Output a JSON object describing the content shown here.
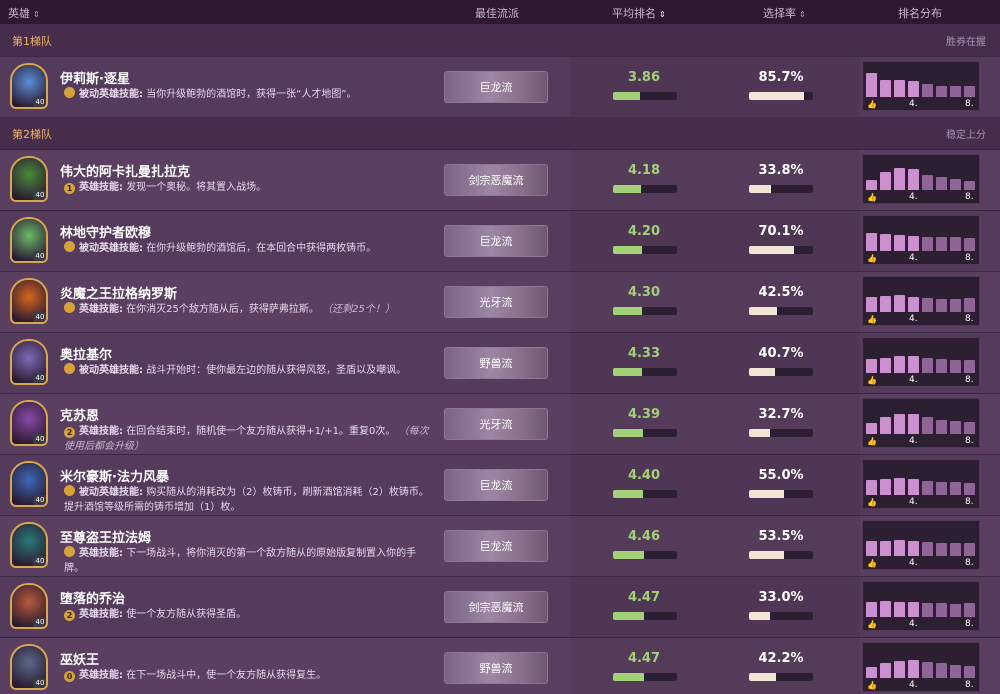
{
  "header": {
    "hero": "英雄",
    "best_build": "最佳流派",
    "avg_rank": "平均排名",
    "pick_rate": "选择率",
    "rank_dist": "排名分布"
  },
  "tiers": [
    {
      "name": "第1梯队",
      "hint": "胜券在握"
    },
    {
      "name": "第2梯队",
      "hint": "稳定上分"
    }
  ],
  "distribution_labels": {
    "low": "4.",
    "high": "8."
  },
  "colors": {
    "avg": "#a3d177",
    "pick": "#f1e6d6",
    "dist_top": "#cc8fd0",
    "dist_bottom": "#8e6596"
  },
  "heroes": [
    {
      "name": "伊莉斯·逐星",
      "cost": "",
      "type": "被动英雄技能:",
      "text": "当你升级鲍勃的酒馆时，获得一张“人才地图”。",
      "note": "",
      "build": "巨龙流",
      "avg": "3.86",
      "avg_pct": 0.42,
      "pick": "85.7%",
      "pick_rate": 0.857,
      "dist": [
        0.85,
        0.62,
        0.6,
        0.58,
        0.45,
        0.4,
        0.38,
        0.4
      ],
      "armor": "40",
      "hue": "#5a8fd6"
    },
    {
      "name": "伟大的阿卡扎曼扎拉克",
      "cost": "1",
      "type": "英雄技能:",
      "text": "发现一个奥秘。将其置入战场。",
      "note": "",
      "build": "剑宗恶魔流",
      "avg": "4.18",
      "avg_pct": 0.44,
      "pick": "33.8%",
      "pick_rate": 0.338,
      "dist": [
        0.35,
        0.65,
        0.8,
        0.75,
        0.55,
        0.45,
        0.38,
        0.32
      ],
      "armor": "40",
      "hue": "#4a8a3a"
    },
    {
      "name": "林地守护者欧穆",
      "cost": "",
      "type": "被动英雄技能:",
      "text": "在你升级鲍勃的酒馆后，在本回合中获得两枚铸币。",
      "note": "",
      "build": "巨龙流",
      "avg": "4.20",
      "avg_pct": 0.45,
      "pick": "70.1%",
      "pick_rate": 0.701,
      "dist": [
        0.65,
        0.6,
        0.58,
        0.55,
        0.5,
        0.5,
        0.5,
        0.48
      ],
      "armor": "40",
      "hue": "#6ab86a"
    },
    {
      "name": "炎魔之王拉格纳罗斯",
      "cost": "",
      "type": "英雄技能:",
      "text": "在你消灭25个敌方随从后，获得萨弗拉斯。",
      "note": "（还剩25个！）",
      "build": "光牙流",
      "avg": "4.30",
      "avg_pct": 0.46,
      "pick": "42.5%",
      "pick_rate": 0.425,
      "dist": [
        0.55,
        0.58,
        0.6,
        0.55,
        0.5,
        0.48,
        0.45,
        0.5
      ],
      "armor": "40",
      "hue": "#d6641e"
    },
    {
      "name": "奥拉基尔",
      "cost": "",
      "type": "被动英雄技能:",
      "text": "战斗开始时：使你最左边的随从获得风怒，圣盾以及嘲讽。",
      "note": "",
      "build": "野兽流",
      "avg": "4.33",
      "avg_pct": 0.46,
      "pick": "40.7%",
      "pick_rate": 0.407,
      "dist": [
        0.5,
        0.55,
        0.6,
        0.62,
        0.55,
        0.5,
        0.48,
        0.45
      ],
      "armor": "40",
      "hue": "#7e6bb8"
    },
    {
      "name": "克苏恩",
      "cost": "2",
      "type": "英雄技能:",
      "text": "在回合结束时，随机使一个友方随从获得+1/+1。重复0次。",
      "note": "（每次使用后都会升级）",
      "build": "光牙流",
      "avg": "4.39",
      "avg_pct": 0.47,
      "pick": "32.7%",
      "pick_rate": 0.327,
      "dist": [
        0.4,
        0.6,
        0.7,
        0.72,
        0.6,
        0.5,
        0.45,
        0.42
      ],
      "armor": "40",
      "hue": "#8a4aa8"
    },
    {
      "name": "米尔豪斯·法力风暴",
      "cost": "",
      "type": "被动英雄技能:",
      "text": "购买随从的消耗改为（2）枚铸币，刷新酒馆消耗（2）枚铸币。提升酒馆等级所需的铸币增加（1）枚。",
      "note": "",
      "build": "巨龙流",
      "avg": "4.40",
      "avg_pct": 0.47,
      "pick": "55.0%",
      "pick_rate": 0.55,
      "dist": [
        0.55,
        0.58,
        0.6,
        0.58,
        0.5,
        0.48,
        0.45,
        0.42
      ],
      "armor": "40",
      "hue": "#3a6ab8"
    },
    {
      "name": "至尊盗王拉法姆",
      "cost": "",
      "type": "英雄技能:",
      "text": "下一场战斗，将你消灭的第一个敌方随从的原始版复制置入你的手牌。",
      "note": "",
      "build": "巨龙流",
      "avg": "4.46",
      "avg_pct": 0.48,
      "pick": "53.5%",
      "pick_rate": 0.535,
      "dist": [
        0.55,
        0.55,
        0.58,
        0.55,
        0.5,
        0.48,
        0.45,
        0.48
      ],
      "armor": "40",
      "hue": "#2a7a78"
    },
    {
      "name": "堕落的乔治",
      "cost": "2",
      "type": "英雄技能:",
      "text": "使一个友方随从获得圣盾。",
      "note": "",
      "build": "剑宗恶魔流",
      "avg": "4.47",
      "avg_pct": 0.48,
      "pick": "33.0%",
      "pick_rate": 0.33,
      "dist": [
        0.55,
        0.58,
        0.55,
        0.55,
        0.5,
        0.5,
        0.48,
        0.5
      ],
      "armor": "40",
      "hue": "#b85a3a"
    },
    {
      "name": "巫妖王",
      "cost": "0",
      "type": "英雄技能:",
      "text": "在下一场战斗中，使一个友方随从获得复生。",
      "note": "",
      "build": "野兽流",
      "avg": "4.47",
      "avg_pct": 0.48,
      "pick": "42.2%",
      "pick_rate": 0.422,
      "dist": [
        0.4,
        0.55,
        0.62,
        0.65,
        0.58,
        0.52,
        0.45,
        0.42
      ],
      "armor": "40",
      "hue": "#5a6a8a"
    }
  ]
}
